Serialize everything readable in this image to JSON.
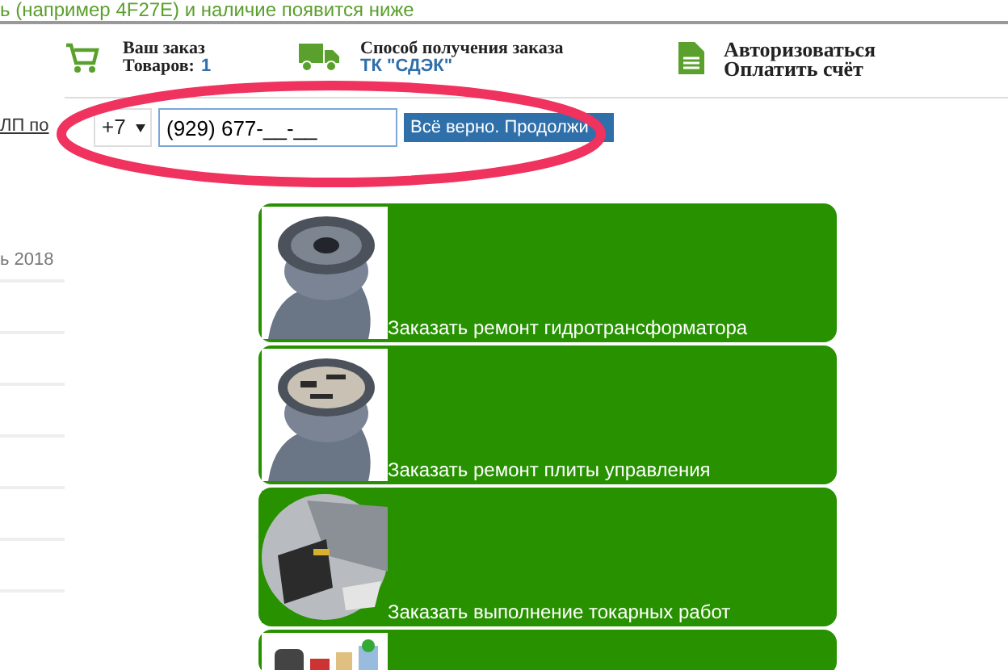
{
  "top_note": "ь (например 4F27E) и наличие появится ниже",
  "side": {
    "link": "ЛП по",
    "date": "ь 2018"
  },
  "header": [
    {
      "kind": "cart",
      "title": "Ваш заказ",
      "label": "Товаров:",
      "value": "1"
    },
    {
      "kind": "truck",
      "title": "Способ получения заказа",
      "value": "ТК \"СДЭК\""
    },
    {
      "kind": "doc",
      "title": "Авторизоваться",
      "value": "Оплатить счёт"
    }
  ],
  "phone": {
    "code": "+7",
    "value": "(929) 677-__-__",
    "button": "Всё верно. Продолжи",
    "highlighted": true
  },
  "services": [
    {
      "label": "Заказать ремонт гидротрансформатора",
      "kind": "picture"
    },
    {
      "label": "Заказать ремонт плиты управления",
      "kind": "picture"
    },
    {
      "label": "Заказать выполнение токарных работ",
      "kind": "picture"
    },
    {
      "kind": "picture"
    }
  ]
}
